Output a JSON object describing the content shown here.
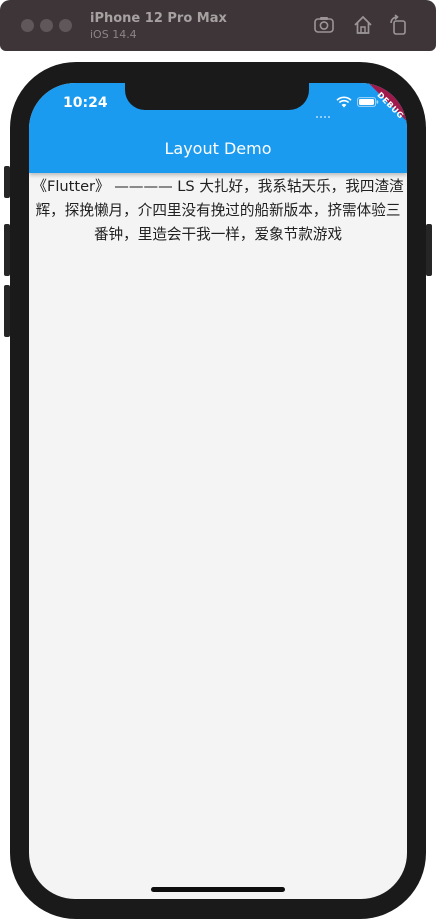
{
  "simulator": {
    "device_name": "iPhone 12 Pro Max",
    "os_version": "iOS 14.4",
    "toolbar_icons": [
      "screenshot-icon",
      "home-icon",
      "rotate-icon"
    ]
  },
  "status_bar": {
    "time": "10:24",
    "icons": [
      "signal-dots-icon",
      "wifi-icon",
      "battery-icon"
    ]
  },
  "app_bar": {
    "title": "Layout Demo",
    "color": "#1a9bef"
  },
  "debug_banner": {
    "label": "DEBUG",
    "color": "#a0194a"
  },
  "body": {
    "text": "《Flutter》 ———— LS 大扎好，我系轱天乐，我四渣渣辉，探挽懒月，介四里没有挽过的船新版本，挤需体验三番钟，里造会干我一样，爱象节款游戏"
  }
}
